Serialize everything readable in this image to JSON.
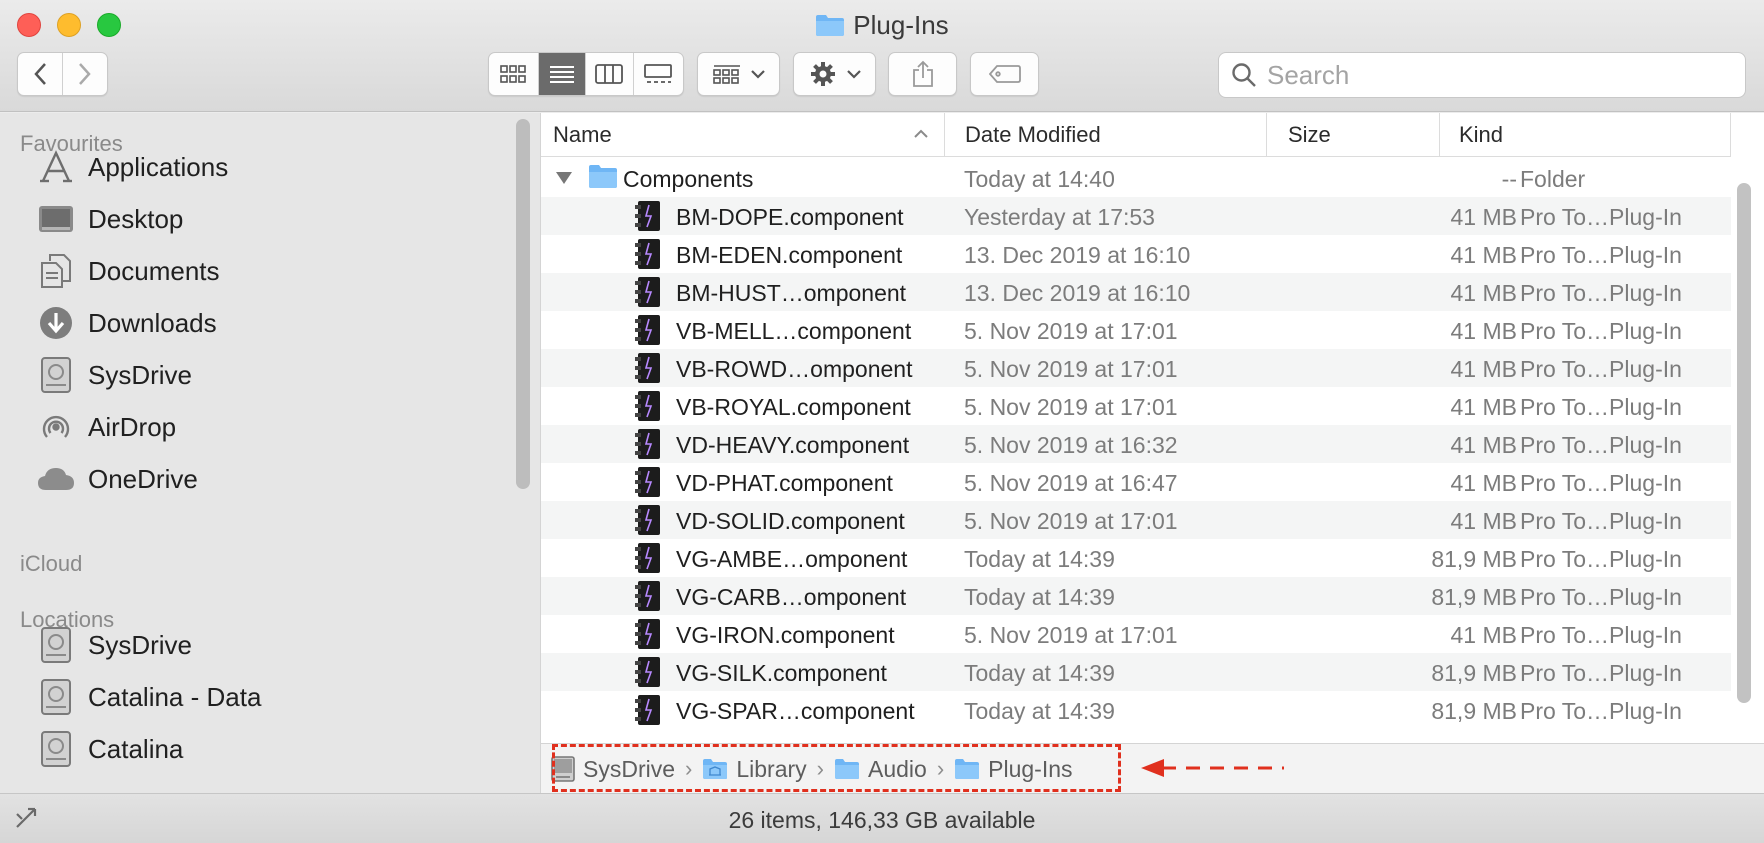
{
  "window": {
    "title": "Plug-Ins"
  },
  "toolbar": {
    "search_placeholder": "Search",
    "view_modes": [
      "icon-view",
      "list-view",
      "column-view",
      "gallery-view"
    ],
    "active_view": "list-view"
  },
  "sidebar": {
    "sections": {
      "favourites": "Favourites",
      "icloud": "iCloud",
      "locations": "Locations"
    },
    "favourites": [
      {
        "label": "Applications",
        "icon": "applications-icon"
      },
      {
        "label": "Desktop",
        "icon": "desktop-icon"
      },
      {
        "label": "Documents",
        "icon": "documents-icon"
      },
      {
        "label": "Downloads",
        "icon": "downloads-icon"
      },
      {
        "label": "SysDrive",
        "icon": "disk-icon"
      },
      {
        "label": "AirDrop",
        "icon": "airdrop-icon"
      },
      {
        "label": "OneDrive",
        "icon": "cloud-icon"
      }
    ],
    "locations": [
      {
        "label": "SysDrive",
        "icon": "disk-icon"
      },
      {
        "label": "Catalina - Data",
        "icon": "disk-icon"
      },
      {
        "label": "Catalina",
        "icon": "disk-icon"
      }
    ]
  },
  "list": {
    "columns": {
      "name": "Name",
      "date": "Date Modified",
      "size": "Size",
      "kind": "Kind"
    },
    "folder": {
      "name": "Components",
      "date": "Today at 14:40",
      "size": "--",
      "kind": "Folder"
    },
    "files": [
      {
        "name": "BM-DOPE.component",
        "date": "Yesterday at 17:53",
        "size": "41 MB",
        "kind": "Pro To…Plug-In"
      },
      {
        "name": "BM-EDEN.component",
        "date": "13. Dec 2019 at 16:10",
        "size": "41 MB",
        "kind": "Pro To…Plug-In"
      },
      {
        "name": "BM-HUST…omponent",
        "date": "13. Dec 2019 at 16:10",
        "size": "41 MB",
        "kind": "Pro To…Plug-In"
      },
      {
        "name": "VB-MELL…component",
        "date": "5. Nov 2019 at 17:01",
        "size": "41 MB",
        "kind": "Pro To…Plug-In"
      },
      {
        "name": "VB-ROWD…omponent",
        "date": "5. Nov 2019 at 17:01",
        "size": "41 MB",
        "kind": "Pro To…Plug-In"
      },
      {
        "name": "VB-ROYAL.component",
        "date": "5. Nov 2019 at 17:01",
        "size": "41 MB",
        "kind": "Pro To…Plug-In"
      },
      {
        "name": "VD-HEAVY.component",
        "date": "5. Nov 2019 at 16:32",
        "size": "41 MB",
        "kind": "Pro To…Plug-In"
      },
      {
        "name": "VD-PHAT.component",
        "date": "5. Nov 2019 at 16:47",
        "size": "41 MB",
        "kind": "Pro To…Plug-In"
      },
      {
        "name": "VD-SOLID.component",
        "date": "5. Nov 2019 at 17:01",
        "size": "41 MB",
        "kind": "Pro To…Plug-In"
      },
      {
        "name": "VG-AMBE…omponent",
        "date": "Today at 14:39",
        "size": "81,9 MB",
        "kind": "Pro To…Plug-In"
      },
      {
        "name": "VG-CARB…omponent",
        "date": "Today at 14:39",
        "size": "81,9 MB",
        "kind": "Pro To…Plug-In"
      },
      {
        "name": "VG-IRON.component",
        "date": "5. Nov 2019 at 17:01",
        "size": "41 MB",
        "kind": "Pro To…Plug-In"
      },
      {
        "name": "VG-SILK.component",
        "date": "Today at 14:39",
        "size": "81,9 MB",
        "kind": "Pro To…Plug-In"
      },
      {
        "name": "VG-SPAR…component",
        "date": "Today at 14:39",
        "size": "81,9 MB",
        "kind": "Pro To…Plug-In"
      }
    ]
  },
  "pathbar": {
    "crumbs": [
      {
        "label": "SysDrive",
        "icon": "disk-icon"
      },
      {
        "label": "Library",
        "icon": "library-folder-icon"
      },
      {
        "label": "Audio",
        "icon": "folder-icon"
      },
      {
        "label": "Plug-Ins",
        "icon": "folder-icon"
      }
    ]
  },
  "status": {
    "text": "26 items, 146,33 GB available"
  },
  "colors": {
    "highlight": "#e0301e",
    "folder": "#6fb6f5",
    "selected_segment": "#6b6b6b"
  }
}
